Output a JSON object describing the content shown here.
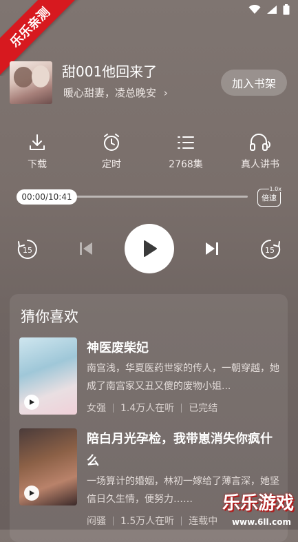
{
  "watermark": {
    "ribbon_text": "乐乐亲测",
    "brand": "乐乐游戏",
    "url": "www.6ll.com"
  },
  "book": {
    "title": "甜001他回来了",
    "subtitle": "暖心甜妻，凌总晚安",
    "subtitle_chevron": "›",
    "add_shelf_label": "加入书架"
  },
  "actions": [
    {
      "label": "下载",
      "icon": "download-icon"
    },
    {
      "label": "定时",
      "icon": "alarm-clock-icon"
    },
    {
      "label": "2768集",
      "icon": "list-icon"
    },
    {
      "label": "真人讲书",
      "icon": "headphones-icon"
    }
  ],
  "player": {
    "time": "00:00/10:41",
    "progress_fraction": 0.0,
    "speed_label": "倍速",
    "speed_value": "1.0x",
    "rewind_label": "15",
    "forward_label": "15"
  },
  "recommend": {
    "title": "猜你喜欢",
    "items": [
      {
        "name": "神医废柴妃",
        "desc": "南宫浅，华夏医药世家的传人，一朝穿越，她成了南宫家又丑又傻的废物小姐...",
        "tag": "女强",
        "listeners": "1.4万人在听",
        "status": "已完结"
      },
      {
        "name": "陪白月光孕检，我带崽消失你疯什么",
        "desc": "一场算计的婚姻，林初一嫁给了薄言深，她坚信日久生情，便努力……",
        "tag": "闷骚",
        "listeners": "1.5万人在听",
        "status": "连载中"
      }
    ]
  },
  "colors": {
    "background": "#7a6f6b",
    "ribbon": "#d7191f",
    "play_button": "#ffffff"
  }
}
